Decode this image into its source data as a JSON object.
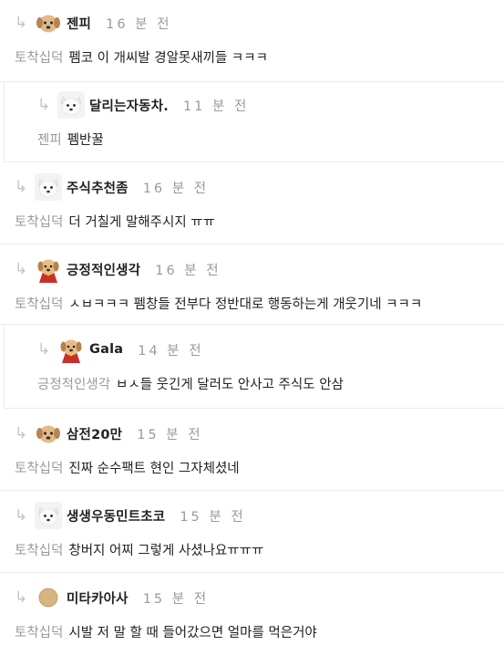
{
  "comments": [
    {
      "nickname": "젠피",
      "time": "16 분 전",
      "mention": "토착십덕",
      "text": "펨코 이 개씨발 경알못새끼들 ㅋㅋㅋ",
      "avatar": "puppy-icon"
    },
    {
      "nickname": "달리는자동차.",
      "time": "11 분 전",
      "mention": "젠피",
      "text": "펨반꿀",
      "avatar": "white-dog-icon"
    },
    {
      "nickname": "주식추천좀",
      "time": "16 분 전",
      "mention": "토착십덕",
      "text": "더 거칠게 말해주시지 ㅠㅠ",
      "avatar": "white-dog-icon"
    },
    {
      "nickname": "긍정적인생각",
      "time": "16 분 전",
      "mention": "토착십덕",
      "text": "ㅅㅂㅋㅋㅋ 펨창들 전부다 정반대로 행동하는게 개웃기네 ㅋㅋㅋ",
      "avatar": "caped-puppy-icon"
    },
    {
      "nickname": "Gala",
      "time": "14 분 전",
      "mention": "긍정적인생각",
      "text": "ㅂㅅ들 웃긴게 달러도 안사고 주식도 안삼",
      "avatar": "caped-puppy-icon"
    },
    {
      "nickname": "삼전20만",
      "time": "15 분 전",
      "mention": "토착십덕",
      "text": "진짜 순수팩트 현인 그자체셨네",
      "avatar": "puppy-icon"
    },
    {
      "nickname": "생생우동민트초코",
      "time": "15 분 전",
      "mention": "토착십덕",
      "text": "창버지 어찌 그렇게 사셨나요ㅠㅠㅠ",
      "avatar": "white-dog-icon"
    },
    {
      "nickname": "미타카아사",
      "time": "15 분 전",
      "mention": "토착십덕",
      "text": "시발 저 말 할 때 들어갔으면 얼마를 먹은거야",
      "avatar": "circle-avatar-icon"
    }
  ]
}
